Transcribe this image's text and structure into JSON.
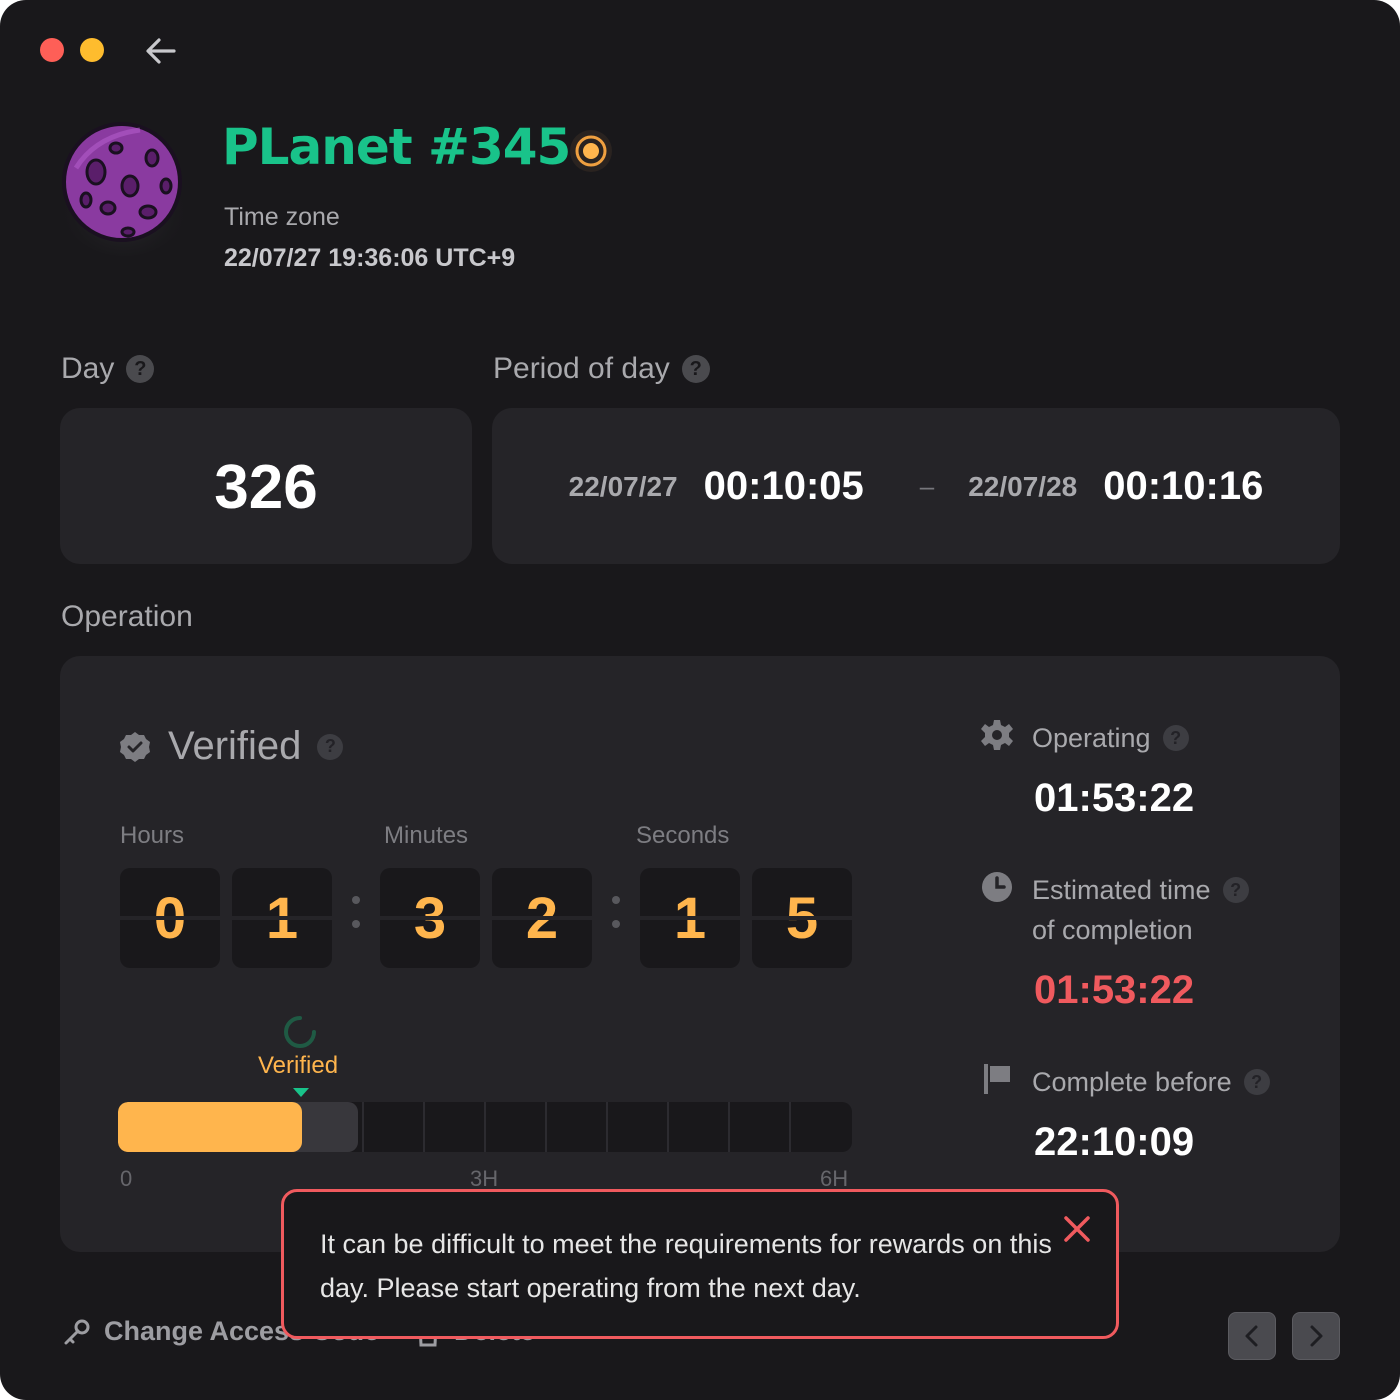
{
  "colors": {
    "background": "#19181b",
    "card": "#252428",
    "accent_orange": "#ffb54d",
    "accent_green": "#19c38a",
    "alert_red": "#f05a5e"
  },
  "header": {
    "planet_name": "PLanet #345",
    "time_zone_label": "Time zone",
    "time_zone_value": "22/07/27 19:36:06 UTC+9"
  },
  "day": {
    "label": "Day",
    "value": "326"
  },
  "period": {
    "label": "Period of day",
    "start_date": "22/07/27",
    "start_time": "00:10:05",
    "separator": "–",
    "end_date": "22/07/28",
    "end_time": "00:10:16"
  },
  "operation": {
    "label": "Operation",
    "status": "Verified",
    "units": {
      "hours": "Hours",
      "minutes": "Minutes",
      "seconds": "Seconds"
    },
    "digits": [
      "0",
      "1",
      "3",
      "2",
      "1",
      "5"
    ],
    "progress": {
      "marker_label": "Verified",
      "fill_fraction": 0.25,
      "verified_fraction": 0.25,
      "axis_ticks": [
        "0",
        "3H",
        "6H"
      ]
    },
    "stats": {
      "operating_label": "Operating",
      "operating_value": "01:53:22",
      "estimated_label_line1": "Estimated time",
      "estimated_label_line2": "of completion",
      "estimated_value": "01:53:22",
      "complete_before_label": "Complete before",
      "complete_before_value": "22:10:09"
    }
  },
  "footer": {
    "change_access_code": "Change Access Code",
    "delete": "Delete"
  },
  "alert": {
    "message": "It can be difficult to meet the requirements for rewards on this day. Please start operating from the next day."
  }
}
